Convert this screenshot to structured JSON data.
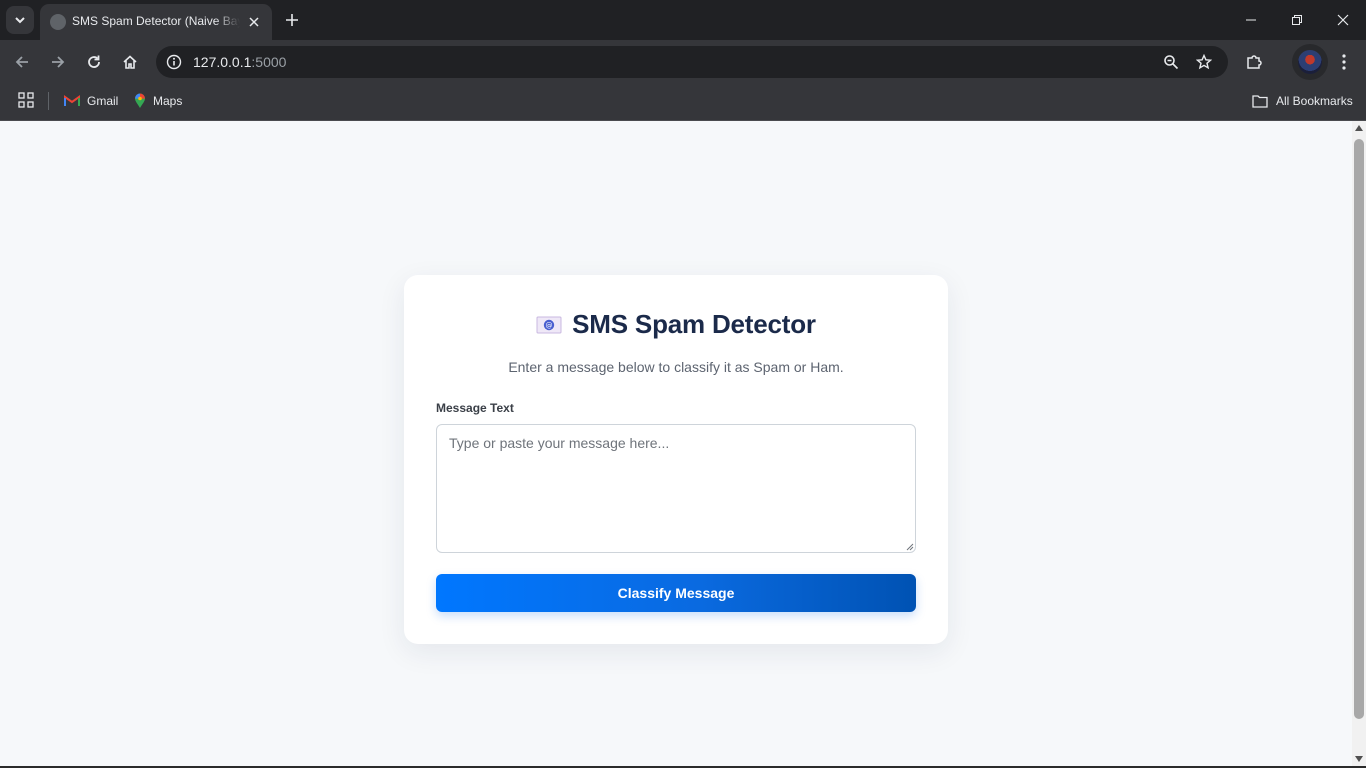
{
  "browser": {
    "tab_title": "SMS Spam Detector (Naive Bayes)",
    "url_host": "127.0.0.1",
    "url_port": ":5000",
    "bookmarks": [
      {
        "label": "Gmail",
        "icon": "gmail-icon"
      },
      {
        "label": "Maps",
        "icon": "maps-icon"
      }
    ],
    "all_bookmarks_label": "All Bookmarks"
  },
  "page": {
    "title": "SMS Spam Detector",
    "title_icon": "envelope-icon",
    "subtitle": "Enter a message below to classify it as Spam or Ham.",
    "field_label": "Message Text",
    "message_placeholder": "Type or paste your message here...",
    "message_value": "",
    "submit_label": "Classify Message"
  },
  "colors": {
    "title": "#1b2a4a",
    "button_start": "#0077ff",
    "button_end": "#0052b3",
    "page_background": "#f6f8fa"
  }
}
